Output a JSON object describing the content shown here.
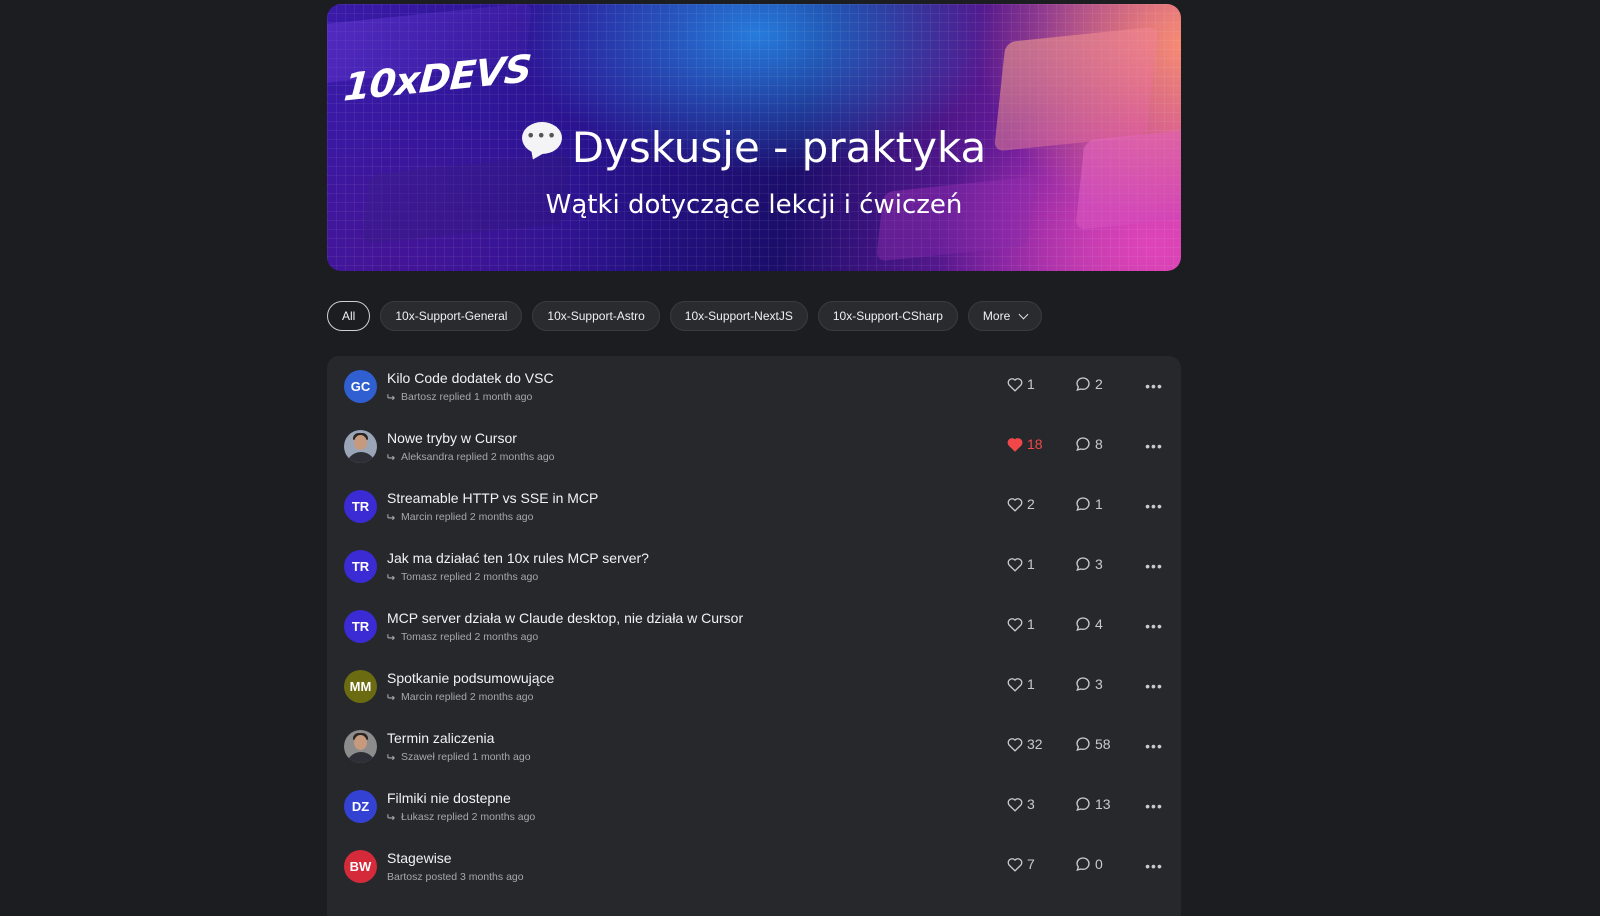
{
  "banner": {
    "logo_text": "10xDEVS",
    "title": "Dyskusje - praktyka",
    "subtitle": "Wątki dotyczące lekcji i ćwiczeń"
  },
  "filters": [
    {
      "label": "All",
      "active": true
    },
    {
      "label": "10x-Support-General",
      "active": false
    },
    {
      "label": "10x-Support-Astro",
      "active": false
    },
    {
      "label": "10x-Support-NextJS",
      "active": false
    },
    {
      "label": "10x-Support-CSharp",
      "active": false
    },
    {
      "label": "More",
      "active": false
    }
  ],
  "colors": {
    "like_active": "#f04848",
    "avatar_gc": "#2f5fd0",
    "avatar_tr": "#3a2bd4",
    "avatar_mm": "#6b6b12",
    "avatar_dz": "#3442d4",
    "avatar_bw": "#d42a3a"
  },
  "threads": [
    {
      "title": "Kilo Code dodatek do VSC",
      "meta": "Bartosz replied 1 month ago",
      "avatar_text": "GC",
      "avatar_color": "#2f5fd0",
      "likes": "1",
      "liked": false,
      "comments": "2",
      "reply_icon": true
    },
    {
      "title": "Nowe tryby w Cursor",
      "meta": "Aleksandra replied 2 months ago",
      "avatar_text": "",
      "avatar_color": "#9aa6b8",
      "likes": "18",
      "liked": true,
      "comments": "8",
      "reply_icon": true
    },
    {
      "title": "Streamable HTTP vs SSE in MCP",
      "meta": "Marcin replied 2 months ago",
      "avatar_text": "TR",
      "avatar_color": "#3a2bd4",
      "likes": "2",
      "liked": false,
      "comments": "1",
      "reply_icon": true
    },
    {
      "title": "Jak ma działać ten 10x rules MCP server?",
      "meta": "Tomasz replied 2 months ago",
      "avatar_text": "TR",
      "avatar_color": "#3a2bd4",
      "likes": "1",
      "liked": false,
      "comments": "3",
      "reply_icon": true
    },
    {
      "title": "MCP server działa w Claude desktop, nie działa w Cursor",
      "meta": "Tomasz replied 2 months ago",
      "avatar_text": "TR",
      "avatar_color": "#3a2bd4",
      "likes": "1",
      "liked": false,
      "comments": "4",
      "reply_icon": true
    },
    {
      "title": "Spotkanie podsumowujące",
      "meta": "Marcin replied 2 months ago",
      "avatar_text": "MM",
      "avatar_color": "#6b6b12",
      "likes": "1",
      "liked": false,
      "comments": "3",
      "reply_icon": true
    },
    {
      "title": "Termin zaliczenia",
      "meta": "Szaweł replied 1 month ago",
      "avatar_text": "",
      "avatar_color": "#8c8c8c",
      "likes": "32",
      "liked": false,
      "comments": "58",
      "reply_icon": true
    },
    {
      "title": "Filmiki nie dostepne",
      "meta": "Łukasz replied 2 months ago",
      "avatar_text": "DZ",
      "avatar_color": "#3442d4",
      "likes": "3",
      "liked": false,
      "comments": "13",
      "reply_icon": true
    },
    {
      "title": "Stagewise",
      "meta": "Bartosz posted 3 months ago",
      "avatar_text": "BW",
      "avatar_color": "#d42a3a",
      "likes": "7",
      "liked": false,
      "comments": "0",
      "reply_icon": false
    }
  ]
}
